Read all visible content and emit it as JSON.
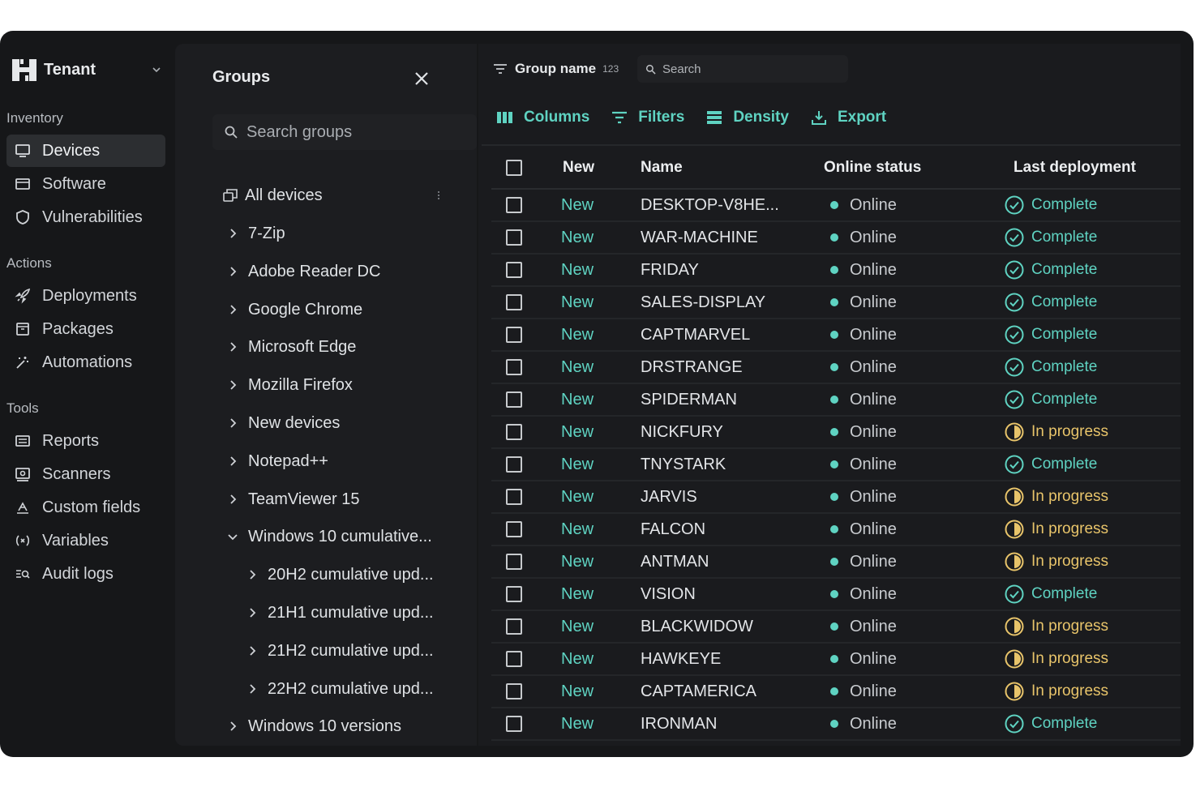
{
  "tenant": {
    "name": "Tenant"
  },
  "sidebar": {
    "sections": [
      {
        "label": "Inventory",
        "items": [
          {
            "label": "Devices",
            "icon": "monitor-icon",
            "active": true
          },
          {
            "label": "Software",
            "icon": "window-icon"
          },
          {
            "label": "Vulnerabilities",
            "icon": "shield-icon"
          }
        ]
      },
      {
        "label": "Actions",
        "items": [
          {
            "label": "Deployments",
            "icon": "rocket-icon"
          },
          {
            "label": "Packages",
            "icon": "package-icon"
          },
          {
            "label": "Automations",
            "icon": "magic-wand-icon"
          }
        ]
      },
      {
        "label": "Tools",
        "items": [
          {
            "label": "Reports",
            "icon": "report-icon"
          },
          {
            "label": "Scanners",
            "icon": "scanner-icon"
          },
          {
            "label": "Custom fields",
            "icon": "custom-fields-icon"
          },
          {
            "label": "Variables",
            "icon": "variables-icon"
          },
          {
            "label": "Audit logs",
            "icon": "audit-logs-icon"
          }
        ]
      }
    ]
  },
  "groups": {
    "title": "Groups",
    "search_placeholder": "Search groups",
    "all_devices": "All devices",
    "items": [
      {
        "label": "7-Zip",
        "level": 0,
        "expanded": false
      },
      {
        "label": "Adobe Reader DC",
        "level": 0,
        "expanded": false
      },
      {
        "label": "Google Chrome",
        "level": 0,
        "expanded": false
      },
      {
        "label": "Microsoft Edge",
        "level": 0,
        "expanded": false
      },
      {
        "label": "Mozilla Firefox",
        "level": 0,
        "expanded": false
      },
      {
        "label": "New devices",
        "level": 0,
        "expanded": false
      },
      {
        "label": "Notepad++",
        "level": 0,
        "expanded": false
      },
      {
        "label": "TeamViewer 15",
        "level": 0,
        "expanded": false
      },
      {
        "label": "Windows 10 cumulative...",
        "level": 0,
        "expanded": true
      },
      {
        "label": "20H2 cumulative upd...",
        "level": 1,
        "expanded": false
      },
      {
        "label": "21H1 cumulative upd...",
        "level": 1,
        "expanded": false
      },
      {
        "label": "21H2 cumulative upd...",
        "level": 1,
        "expanded": false
      },
      {
        "label": "22H2 cumulative upd...",
        "level": 1,
        "expanded": false
      },
      {
        "label": "Windows 10 versions",
        "level": 0,
        "expanded": false
      }
    ]
  },
  "topbar": {
    "group_name": "Group name",
    "count": "123",
    "search_placeholder": "Search"
  },
  "toolbar": {
    "columns": "Columns",
    "filters": "Filters",
    "density": "Density",
    "export": "Export"
  },
  "table": {
    "headers": {
      "new": "New",
      "name": "Name",
      "online_status": "Online status",
      "last_deployment": "Last deployment"
    },
    "rows": [
      {
        "new": "New",
        "name": "DESKTOP-V8HE...",
        "status": "Online",
        "deployment": "Complete"
      },
      {
        "new": "New",
        "name": "WAR-MACHINE",
        "status": "Online",
        "deployment": "Complete"
      },
      {
        "new": "New",
        "name": "FRIDAY",
        "status": "Online",
        "deployment": "Complete"
      },
      {
        "new": "New",
        "name": "SALES-DISPLAY",
        "status": "Online",
        "deployment": "Complete"
      },
      {
        "new": "New",
        "name": "CAPTMARVEL",
        "status": "Online",
        "deployment": "Complete"
      },
      {
        "new": "New",
        "name": "DRSTRANGE",
        "status": "Online",
        "deployment": "Complete"
      },
      {
        "new": "New",
        "name": "SPIDERMAN",
        "status": "Online",
        "deployment": "Complete"
      },
      {
        "new": "New",
        "name": "NICKFURY",
        "status": "Online",
        "deployment": "In progress"
      },
      {
        "new": "New",
        "name": "TNYSTARK",
        "status": "Online",
        "deployment": "Complete"
      },
      {
        "new": "New",
        "name": "JARVIS",
        "status": "Online",
        "deployment": "In progress"
      },
      {
        "new": "New",
        "name": "FALCON",
        "status": "Online",
        "deployment": "In progress"
      },
      {
        "new": "New",
        "name": "ANTMAN",
        "status": "Online",
        "deployment": "In progress"
      },
      {
        "new": "New",
        "name": "VISION",
        "status": "Online",
        "deployment": "Complete"
      },
      {
        "new": "New",
        "name": "BLACKWIDOW",
        "status": "Online",
        "deployment": "In progress"
      },
      {
        "new": "New",
        "name": "HAWKEYE",
        "status": "Online",
        "deployment": "In progress"
      },
      {
        "new": "New",
        "name": "CAPTAMERICA",
        "status": "Online",
        "deployment": "In progress"
      },
      {
        "new": "New",
        "name": "IRONMAN",
        "status": "Online",
        "deployment": "Complete"
      }
    ]
  },
  "colors": {
    "accent": "#5fd3c2",
    "in_progress": "#e8c46a",
    "background": "#161719"
  }
}
